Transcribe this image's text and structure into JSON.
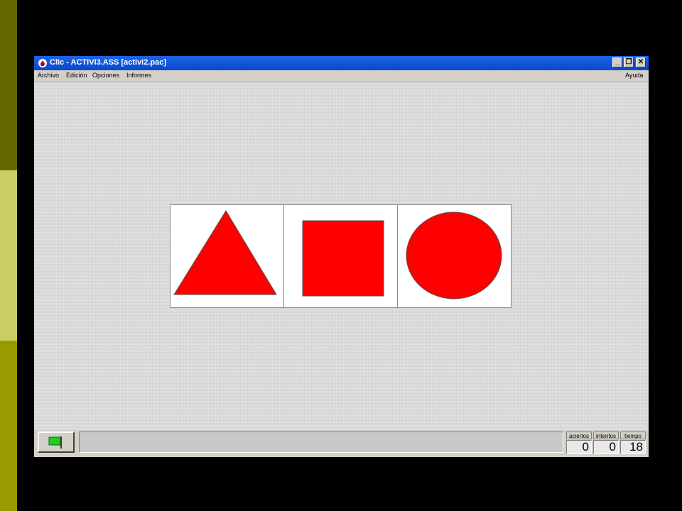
{
  "window": {
    "title": "Clic - ACTIVI3.ASS [activi2.pac]",
    "buttons": {
      "minimize": "_",
      "restore": "❐",
      "close": "✕"
    }
  },
  "menu": {
    "items": [
      "Archivo",
      "Edición",
      "Opciones",
      "Informes"
    ],
    "help": "Ayuda"
  },
  "activity": {
    "cells": [
      {
        "shape": "triangle",
        "color": "#ff0000"
      },
      {
        "shape": "square",
        "color": "#ff0000"
      },
      {
        "shape": "circle",
        "color": "#ff0000"
      }
    ]
  },
  "status": {
    "counters": [
      {
        "label": "aciertos",
        "value": "0"
      },
      {
        "label": "intentos",
        "value": "0"
      },
      {
        "label": "tiempo",
        "value": "18"
      }
    ]
  },
  "icons": {
    "app": "clic-app-icon",
    "start": "green-flag-icon"
  }
}
